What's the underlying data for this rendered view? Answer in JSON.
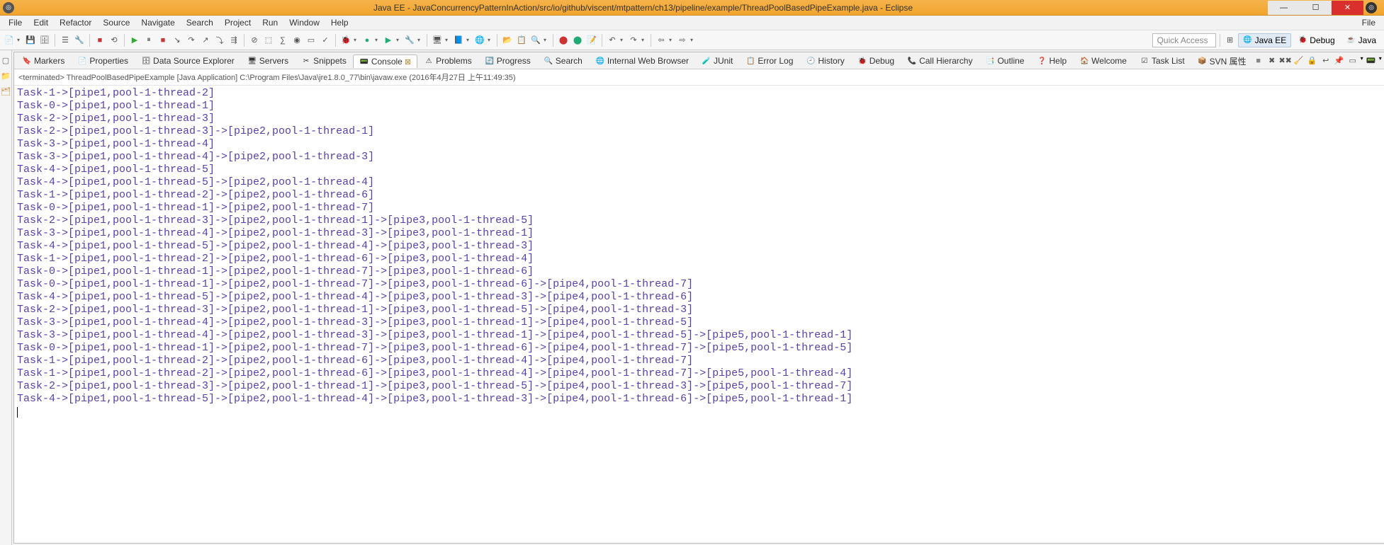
{
  "window": {
    "title": "Java EE - JavaConcurrencyPatternInAction/src/io/github/viscent/mtpattern/ch13/pipeline/example/ThreadPoolBasedPipeExample.java - Eclipse"
  },
  "menubar": {
    "items": [
      "File",
      "Edit",
      "Refactor",
      "Source",
      "Navigate",
      "Search",
      "Project",
      "Run",
      "Window",
      "Help"
    ]
  },
  "rightmenu": {
    "file": "File"
  },
  "quick_access": {
    "placeholder": "Quick Access"
  },
  "perspectives": {
    "javaee": "Java EE",
    "debug": "Debug",
    "java": "Java"
  },
  "view_tabs": {
    "items": [
      {
        "icon": "🔖",
        "label": "Markers"
      },
      {
        "icon": "📄",
        "label": "Properties"
      },
      {
        "icon": "🗄",
        "label": "Data Source Explorer"
      },
      {
        "icon": "🖥",
        "label": "Servers"
      },
      {
        "icon": "✂",
        "label": "Snippets"
      },
      {
        "icon": "📟",
        "label": "Console",
        "active": true
      },
      {
        "icon": "⚠",
        "label": "Problems"
      },
      {
        "icon": "🔄",
        "label": "Progress"
      },
      {
        "icon": "🔍",
        "label": "Search"
      },
      {
        "icon": "🌐",
        "label": "Internal Web Browser"
      },
      {
        "icon": "🧪",
        "label": "JUnit"
      },
      {
        "icon": "📋",
        "label": "Error Log"
      },
      {
        "icon": "🕘",
        "label": "History"
      },
      {
        "icon": "🐞",
        "label": "Debug"
      },
      {
        "icon": "📞",
        "label": "Call Hierarchy"
      },
      {
        "icon": "📑",
        "label": "Outline"
      },
      {
        "icon": "❓",
        "label": "Help"
      },
      {
        "icon": "🏠",
        "label": "Welcome"
      },
      {
        "icon": "☑",
        "label": "Task List"
      },
      {
        "icon": "📦",
        "label": "SVN 属性"
      }
    ]
  },
  "console": {
    "header": "<terminated> ThreadPoolBasedPipeExample [Java Application] C:\\Program Files\\Java\\jre1.8.0_77\\bin\\javaw.exe (2016年4月27日 上午11:49:35)",
    "lines": [
      "Task-1->[pipe1,pool-1-thread-2]",
      "Task-0->[pipe1,pool-1-thread-1]",
      "Task-2->[pipe1,pool-1-thread-3]",
      "Task-2->[pipe1,pool-1-thread-3]->[pipe2,pool-1-thread-1]",
      "Task-3->[pipe1,pool-1-thread-4]",
      "Task-3->[pipe1,pool-1-thread-4]->[pipe2,pool-1-thread-3]",
      "Task-4->[pipe1,pool-1-thread-5]",
      "Task-4->[pipe1,pool-1-thread-5]->[pipe2,pool-1-thread-4]",
      "Task-1->[pipe1,pool-1-thread-2]->[pipe2,pool-1-thread-6]",
      "Task-0->[pipe1,pool-1-thread-1]->[pipe2,pool-1-thread-7]",
      "Task-2->[pipe1,pool-1-thread-3]->[pipe2,pool-1-thread-1]->[pipe3,pool-1-thread-5]",
      "Task-3->[pipe1,pool-1-thread-4]->[pipe2,pool-1-thread-3]->[pipe3,pool-1-thread-1]",
      "Task-4->[pipe1,pool-1-thread-5]->[pipe2,pool-1-thread-4]->[pipe3,pool-1-thread-3]",
      "Task-1->[pipe1,pool-1-thread-2]->[pipe2,pool-1-thread-6]->[pipe3,pool-1-thread-4]",
      "Task-0->[pipe1,pool-1-thread-1]->[pipe2,pool-1-thread-7]->[pipe3,pool-1-thread-6]",
      "Task-0->[pipe1,pool-1-thread-1]->[pipe2,pool-1-thread-7]->[pipe3,pool-1-thread-6]->[pipe4,pool-1-thread-7]",
      "Task-4->[pipe1,pool-1-thread-5]->[pipe2,pool-1-thread-4]->[pipe3,pool-1-thread-3]->[pipe4,pool-1-thread-6]",
      "Task-2->[pipe1,pool-1-thread-3]->[pipe2,pool-1-thread-1]->[pipe3,pool-1-thread-5]->[pipe4,pool-1-thread-3]",
      "Task-3->[pipe1,pool-1-thread-4]->[pipe2,pool-1-thread-3]->[pipe3,pool-1-thread-1]->[pipe4,pool-1-thread-5]",
      "Task-3->[pipe1,pool-1-thread-4]->[pipe2,pool-1-thread-3]->[pipe3,pool-1-thread-1]->[pipe4,pool-1-thread-5]->[pipe5,pool-1-thread-1]",
      "Task-0->[pipe1,pool-1-thread-1]->[pipe2,pool-1-thread-7]->[pipe3,pool-1-thread-6]->[pipe4,pool-1-thread-7]->[pipe5,pool-1-thread-5]",
      "Task-1->[pipe1,pool-1-thread-2]->[pipe2,pool-1-thread-6]->[pipe3,pool-1-thread-4]->[pipe4,pool-1-thread-7]",
      "Task-1->[pipe1,pool-1-thread-2]->[pipe2,pool-1-thread-6]->[pipe3,pool-1-thread-4]->[pipe4,pool-1-thread-7]->[pipe5,pool-1-thread-4]",
      "Task-2->[pipe1,pool-1-thread-3]->[pipe2,pool-1-thread-1]->[pipe3,pool-1-thread-5]->[pipe4,pool-1-thread-3]->[pipe5,pool-1-thread-7]",
      "Task-4->[pipe1,pool-1-thread-5]->[pipe2,pool-1-thread-4]->[pipe3,pool-1-thread-3]->[pipe4,pool-1-thread-6]->[pipe5,pool-1-thread-1]"
    ]
  }
}
